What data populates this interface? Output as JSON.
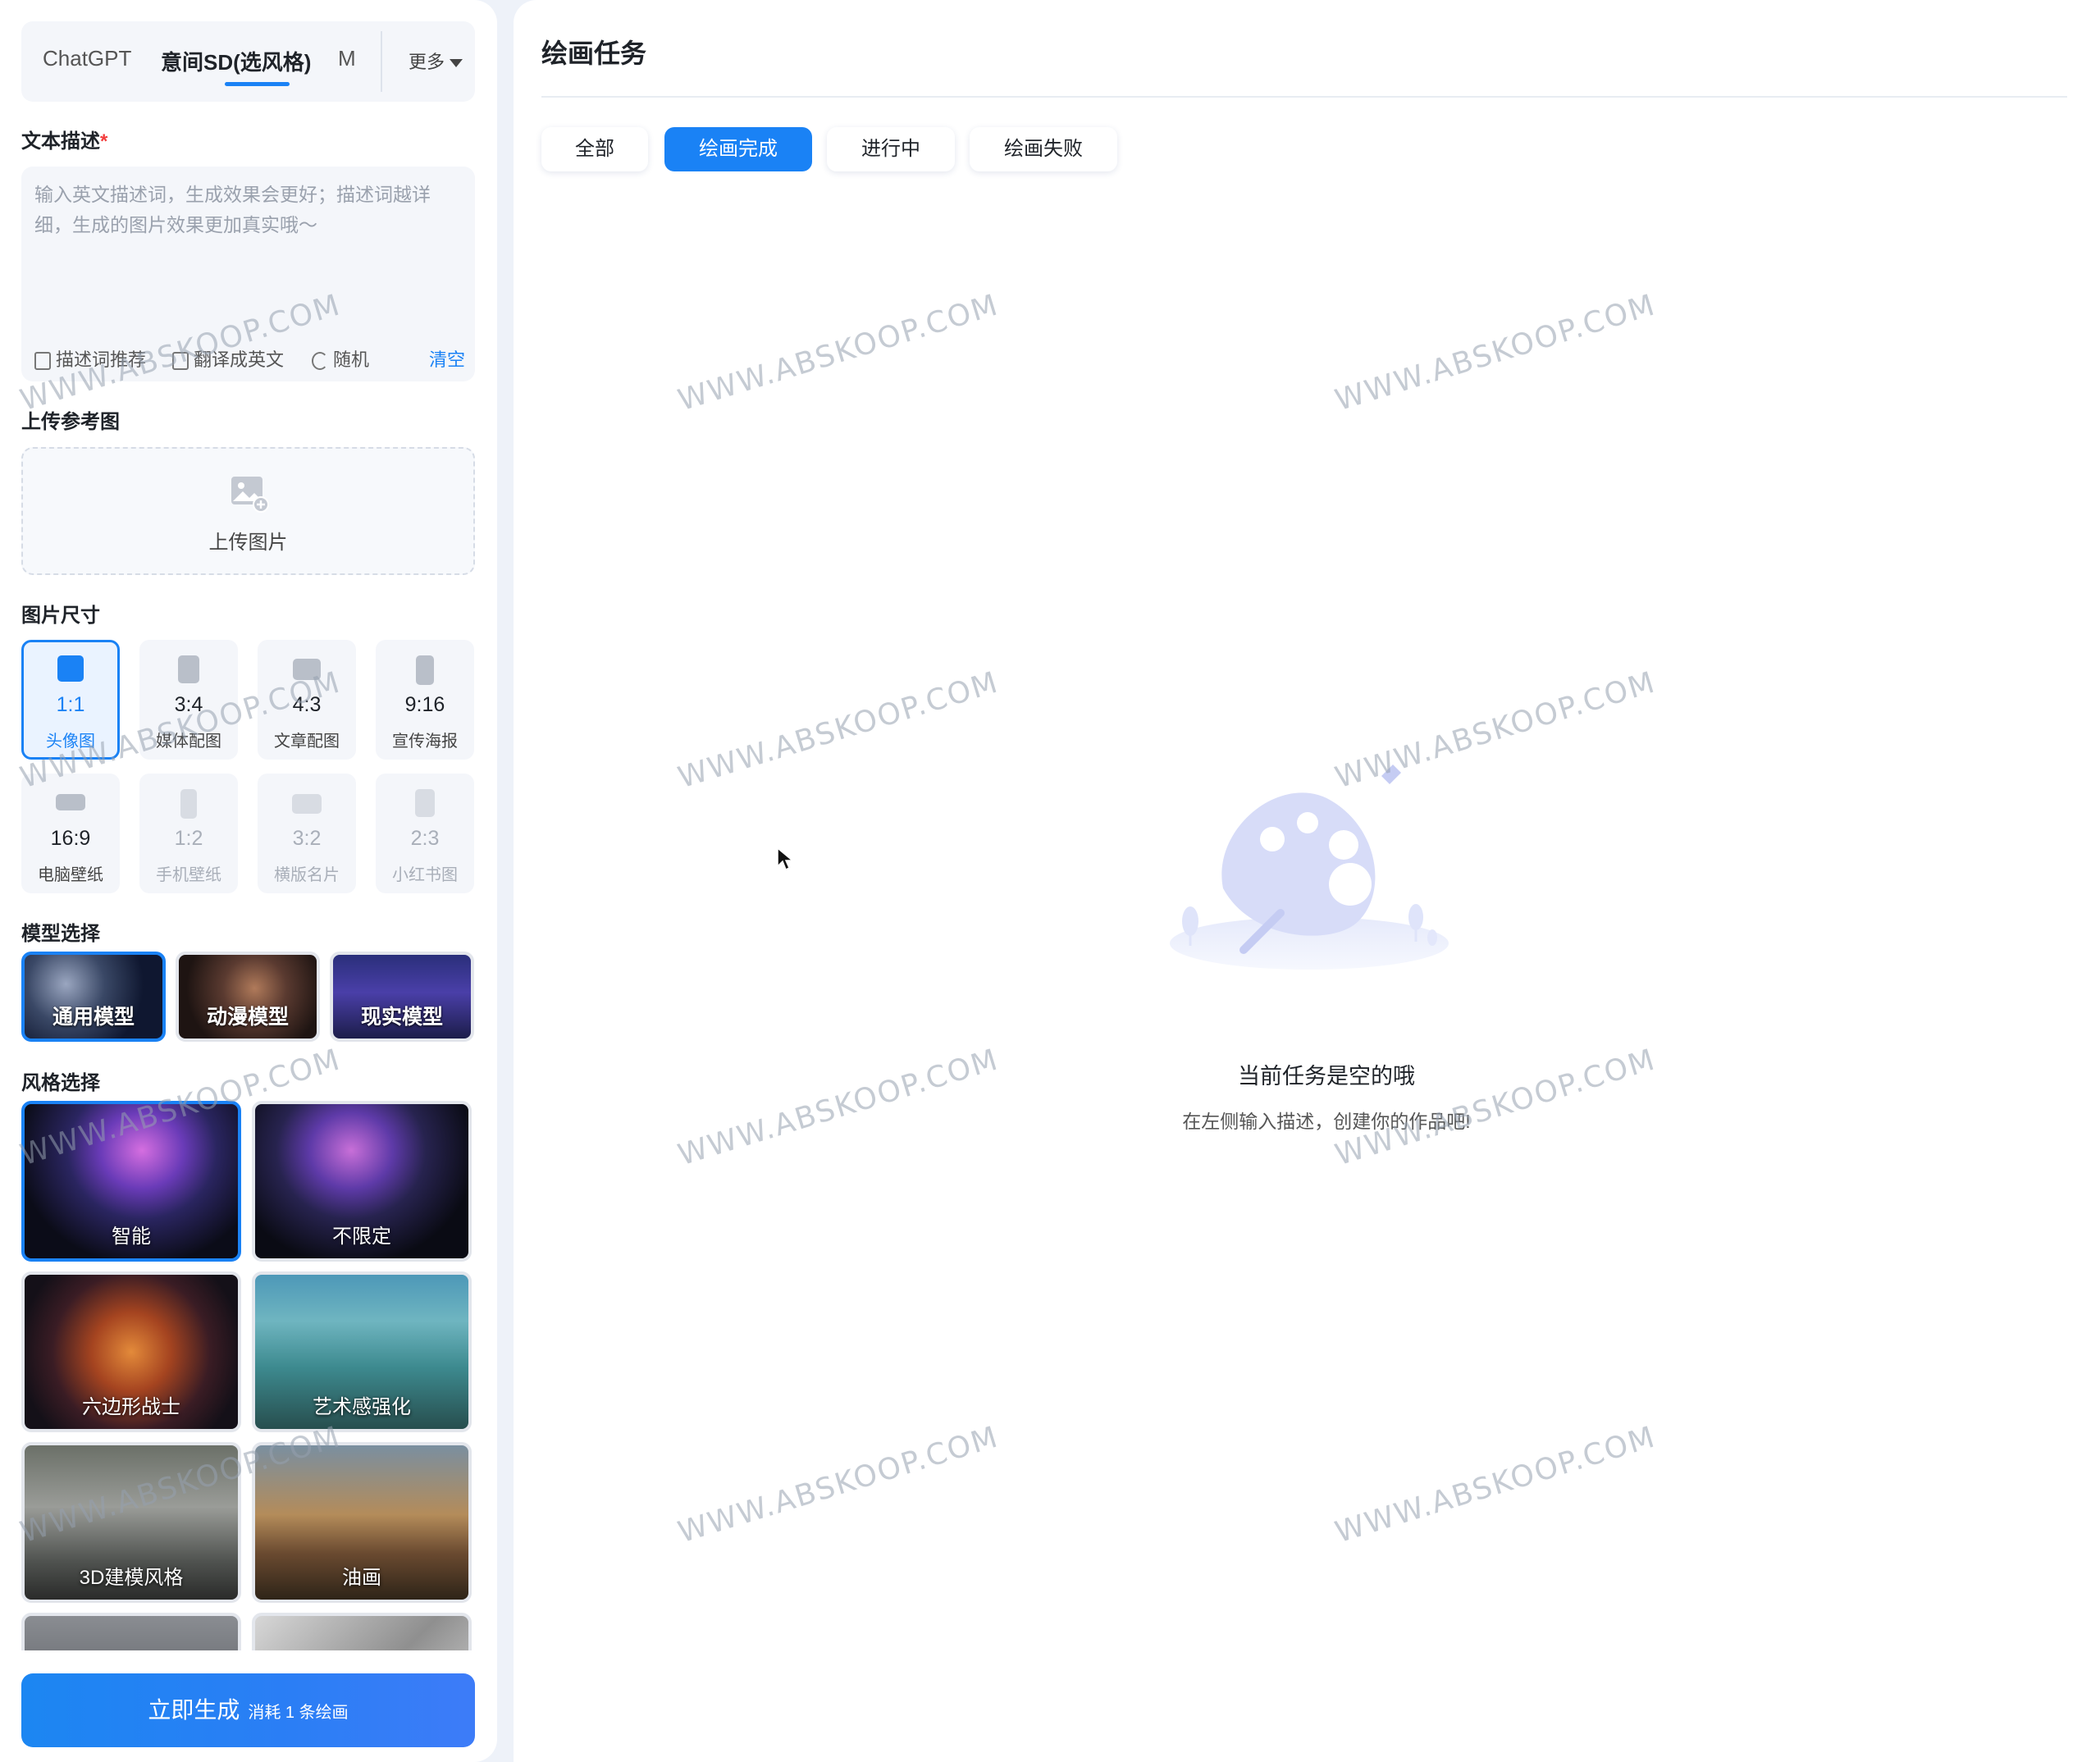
{
  "left_panel": {
    "tabs": [
      {
        "label": "ChatGPT"
      },
      {
        "label": "意间SD(选风格)"
      },
      {
        "label": "M"
      }
    ],
    "more_label": "更多",
    "text_desc": {
      "label": "文本描述",
      "required_mark": "*",
      "placeholder": "输入英文描述词，生成效果会更好；描述词越详细，生成的图片效果更加真实哦～",
      "tools": [
        "描述词推荐",
        "翻译成英文",
        "随机"
      ],
      "clear_label": "清空"
    },
    "upload": {
      "label": "上传参考图",
      "button_text": "上传图片"
    },
    "size": {
      "label": "图片尺寸",
      "options": [
        {
          "ratio": "1:1",
          "name": "头像图",
          "selected": true,
          "disabled": false
        },
        {
          "ratio": "3:4",
          "name": "媒体配图",
          "selected": false,
          "disabled": false
        },
        {
          "ratio": "4:3",
          "name": "文章配图",
          "selected": false,
          "disabled": false
        },
        {
          "ratio": "9:16",
          "name": "宣传海报",
          "selected": false,
          "disabled": false
        },
        {
          "ratio": "16:9",
          "name": "电脑壁纸",
          "selected": false,
          "disabled": false
        },
        {
          "ratio": "1:2",
          "name": "手机壁纸",
          "selected": false,
          "disabled": true
        },
        {
          "ratio": "3:2",
          "name": "横版名片",
          "selected": false,
          "disabled": true
        },
        {
          "ratio": "2:3",
          "name": "小红书图",
          "selected": false,
          "disabled": true
        }
      ]
    },
    "model": {
      "label": "模型选择",
      "options": [
        {
          "name": "通用模型",
          "selected": true
        },
        {
          "name": "动漫模型",
          "selected": false
        },
        {
          "name": "现实模型",
          "selected": false
        }
      ]
    },
    "style": {
      "label": "风格选择",
      "options": [
        {
          "name": "智能",
          "selected": true
        },
        {
          "name": "不限定",
          "selected": false
        },
        {
          "name": "六边形战士",
          "selected": false
        },
        {
          "name": "艺术感强化",
          "selected": false
        },
        {
          "name": "3D建模风格",
          "selected": false
        },
        {
          "name": "油画",
          "selected": false
        },
        {
          "name": "",
          "selected": false
        },
        {
          "name": "",
          "selected": false
        }
      ]
    },
    "generate": {
      "label": "立即生成",
      "cost": "消耗 1 条绘画"
    }
  },
  "right_panel": {
    "title": "绘画任务",
    "filters": [
      {
        "label": "全部",
        "active": false
      },
      {
        "label": "绘画完成",
        "active": true
      },
      {
        "label": "进行中",
        "active": false
      },
      {
        "label": "绘画失败",
        "active": false
      }
    ],
    "empty": {
      "title": "当前任务是空的哦",
      "subtitle": "在左侧输入描述，创建你的作品吧!"
    }
  },
  "watermark": "WWW.ABSKOOP.COM",
  "colors": {
    "accent": "#1a82f5",
    "required": "#f23c3c"
  }
}
